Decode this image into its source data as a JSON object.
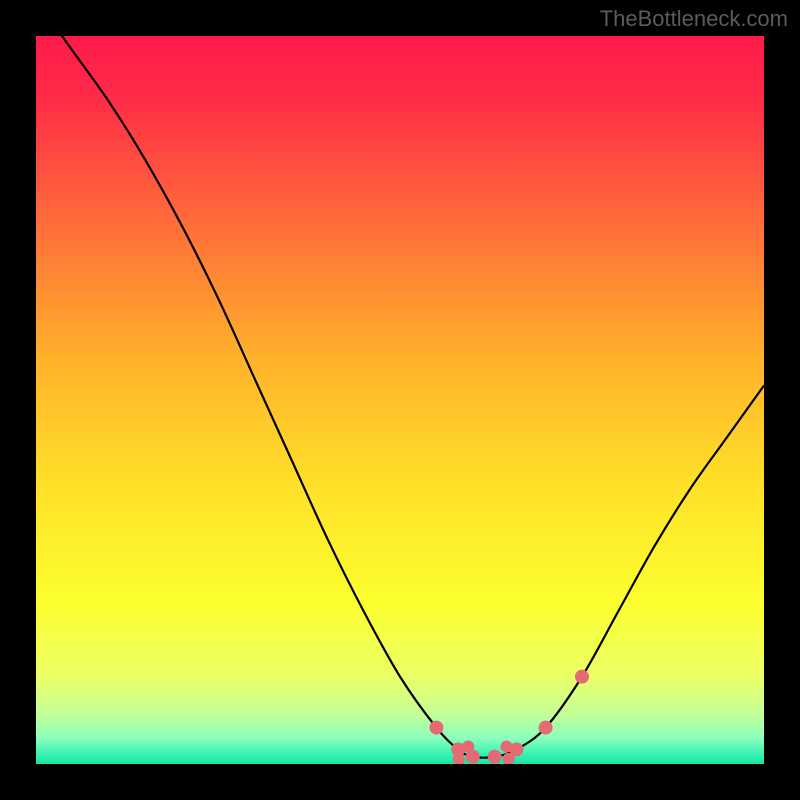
{
  "watermark": "TheBottleneck.com",
  "chart_data": {
    "type": "line",
    "title": "",
    "xlabel": "",
    "ylabel": "",
    "xlim": [
      0,
      100
    ],
    "ylim": [
      0,
      100
    ],
    "x": [
      0,
      5,
      10,
      15,
      20,
      25,
      30,
      35,
      40,
      45,
      50,
      55,
      58,
      60,
      63,
      66,
      70,
      75,
      80,
      85,
      90,
      95,
      100
    ],
    "values": [
      105,
      98,
      91,
      83,
      74,
      64,
      53,
      42,
      31,
      21,
      12,
      5,
      2,
      1,
      1,
      2,
      5,
      12,
      21,
      30,
      38,
      45,
      52
    ],
    "dots_index": [
      11,
      12,
      13,
      14,
      15,
      16,
      17
    ],
    "dot_color": "#e46a74",
    "line_color": "#000000",
    "gradient_stops": [
      {
        "offset": 0.0,
        "color": "#ff1a4b"
      },
      {
        "offset": 0.08,
        "color": "#ff2a47"
      },
      {
        "offset": 0.25,
        "color": "#ff6a3a"
      },
      {
        "offset": 0.45,
        "color": "#ffb42a"
      },
      {
        "offset": 0.62,
        "color": "#ffe129"
      },
      {
        "offset": 0.78,
        "color": "#fcff2e"
      },
      {
        "offset": 0.88,
        "color": "#eaff66"
      },
      {
        "offset": 0.93,
        "color": "#c6ff96"
      },
      {
        "offset": 0.965,
        "color": "#8affbc"
      },
      {
        "offset": 0.985,
        "color": "#3bf4b4"
      },
      {
        "offset": 1.0,
        "color": "#17e3a5"
      }
    ]
  }
}
